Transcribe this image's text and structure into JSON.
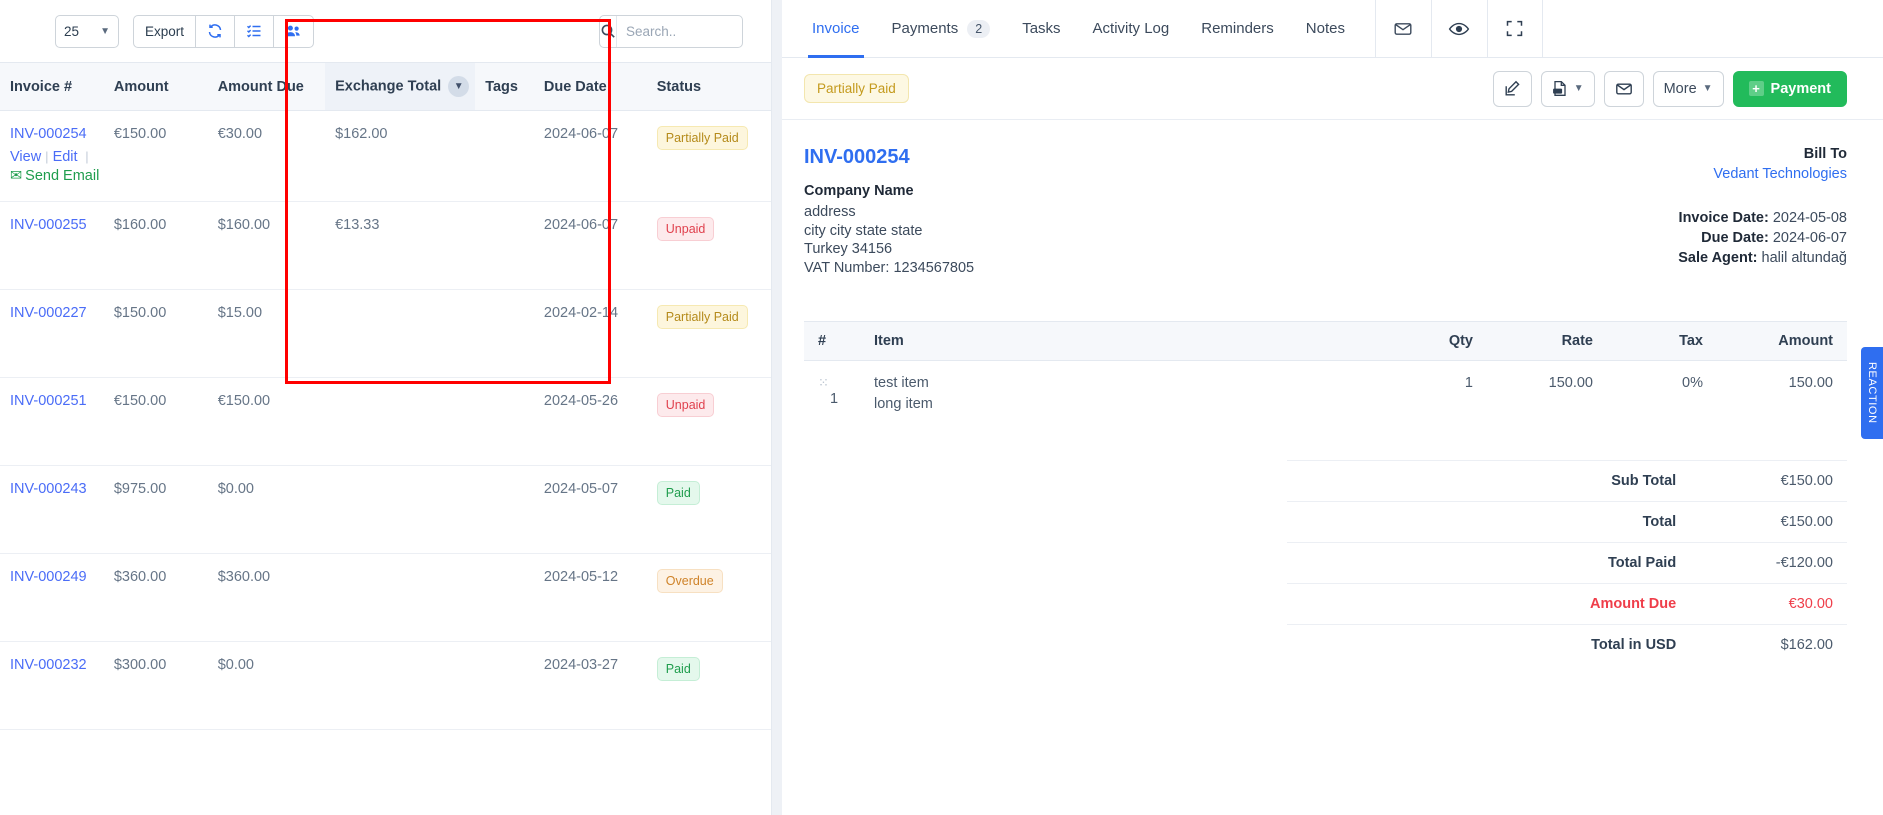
{
  "left": {
    "toolbar": {
      "per_page": "25",
      "export_label": "Export",
      "refresh_icon": "refresh-icon",
      "columns_icon": "list-checks-icon",
      "clients_icon": "users-icon",
      "search_placeholder": "Search..",
      "search_value": ""
    },
    "table": {
      "columns": [
        "Invoice #",
        "Amount",
        "Amount Due",
        "Exchange Total",
        "Tags",
        "Due Date",
        "Status"
      ],
      "sorted_column": "Exchange Total",
      "rows": [
        {
          "invoice_no": "INV-000254",
          "amount": "€150.00",
          "amount_due": "€30.00",
          "exchange_total": "$162.00",
          "tags": "",
          "due_date": "2024-06-07",
          "status": "Partially Paid",
          "status_kind": "partial",
          "actions": {
            "view": "View",
            "edit": "Edit",
            "send": "Send Email"
          }
        },
        {
          "invoice_no": "INV-000255",
          "amount": "$160.00",
          "amount_due": "$160.00",
          "exchange_total": "€13.33",
          "tags": "",
          "due_date": "2024-06-07",
          "status": "Unpaid",
          "status_kind": "unpaid"
        },
        {
          "invoice_no": "INV-000227",
          "amount": "$150.00",
          "amount_due": "$15.00",
          "exchange_total": "",
          "tags": "",
          "due_date": "2024-02-14",
          "status": "Partially Paid",
          "status_kind": "partial"
        },
        {
          "invoice_no": "INV-000251",
          "amount": "€150.00",
          "amount_due": "€150.00",
          "exchange_total": "",
          "tags": "",
          "due_date": "2024-05-26",
          "status": "Unpaid",
          "status_kind": "unpaid"
        },
        {
          "invoice_no": "INV-000243",
          "amount": "$975.00",
          "amount_due": "$0.00",
          "exchange_total": "",
          "tags": "",
          "due_date": "2024-05-07",
          "status": "Paid",
          "status_kind": "paid"
        },
        {
          "invoice_no": "INV-000249",
          "amount": "$360.00",
          "amount_due": "$360.00",
          "exchange_total": "",
          "tags": "",
          "due_date": "2024-05-12",
          "status": "Overdue",
          "status_kind": "overdue"
        },
        {
          "invoice_no": "INV-000232",
          "amount": "$300.00",
          "amount_due": "$0.00",
          "exchange_total": "",
          "tags": "",
          "due_date": "2024-03-27",
          "status": "Paid",
          "status_kind": "paid"
        }
      ]
    }
  },
  "right": {
    "tabs": [
      {
        "label": "Invoice",
        "count": "",
        "active": true
      },
      {
        "label": "Payments",
        "count": "2",
        "active": false
      },
      {
        "label": "Tasks",
        "count": "",
        "active": false
      },
      {
        "label": "Activity Log",
        "count": "",
        "active": false
      },
      {
        "label": "Reminders",
        "count": "",
        "active": false
      },
      {
        "label": "Notes",
        "count": "",
        "active": false
      }
    ],
    "tab_icons": [
      "envelope-icon",
      "eye-icon",
      "expand-icon"
    ],
    "status_pill": "Partially Paid",
    "actions": {
      "edit_icon": "edit-pencil-icon",
      "pdf_icon": "pdf-file-icon",
      "mail_icon": "envelope-icon",
      "more_label": "More",
      "payment_label": "Payment"
    },
    "invoice": {
      "number": "INV-000254",
      "company_name": "Company Name",
      "address_lines": [
        "address",
        "city city state state",
        "Turkey 34156",
        "VAT Number: 1234567805"
      ],
      "bill_to_label": "Bill To",
      "bill_to_name": "Vedant Technologies",
      "invoice_date_label": "Invoice Date:",
      "invoice_date": "2024-05-08",
      "due_date_label": "Due Date:",
      "due_date": "2024-06-07",
      "sale_agent_label": "Sale Agent:",
      "sale_agent": "halil altundağ"
    },
    "items_table": {
      "columns": [
        "#",
        "Item",
        "Qty",
        "Rate",
        "Tax",
        "Amount"
      ],
      "rows": [
        {
          "num": "1",
          "item": "test item",
          "item_desc": "long item",
          "qty": "1",
          "rate": "150.00",
          "tax": "0%",
          "amount": "150.00"
        }
      ]
    },
    "totals": [
      {
        "label": "Sub Total",
        "value": "€150.00",
        "kind": "normal"
      },
      {
        "label": "Total",
        "value": "€150.00",
        "kind": "normal"
      },
      {
        "label": "Total Paid",
        "value": "-€120.00",
        "kind": "normal"
      },
      {
        "label": "Amount Due",
        "value": "€30.00",
        "kind": "due"
      },
      {
        "label": "Total in USD",
        "value": "$162.00",
        "kind": "normal"
      }
    ],
    "reaction_tab": "REACTION"
  },
  "annotations": {
    "color": "#ff0000"
  }
}
